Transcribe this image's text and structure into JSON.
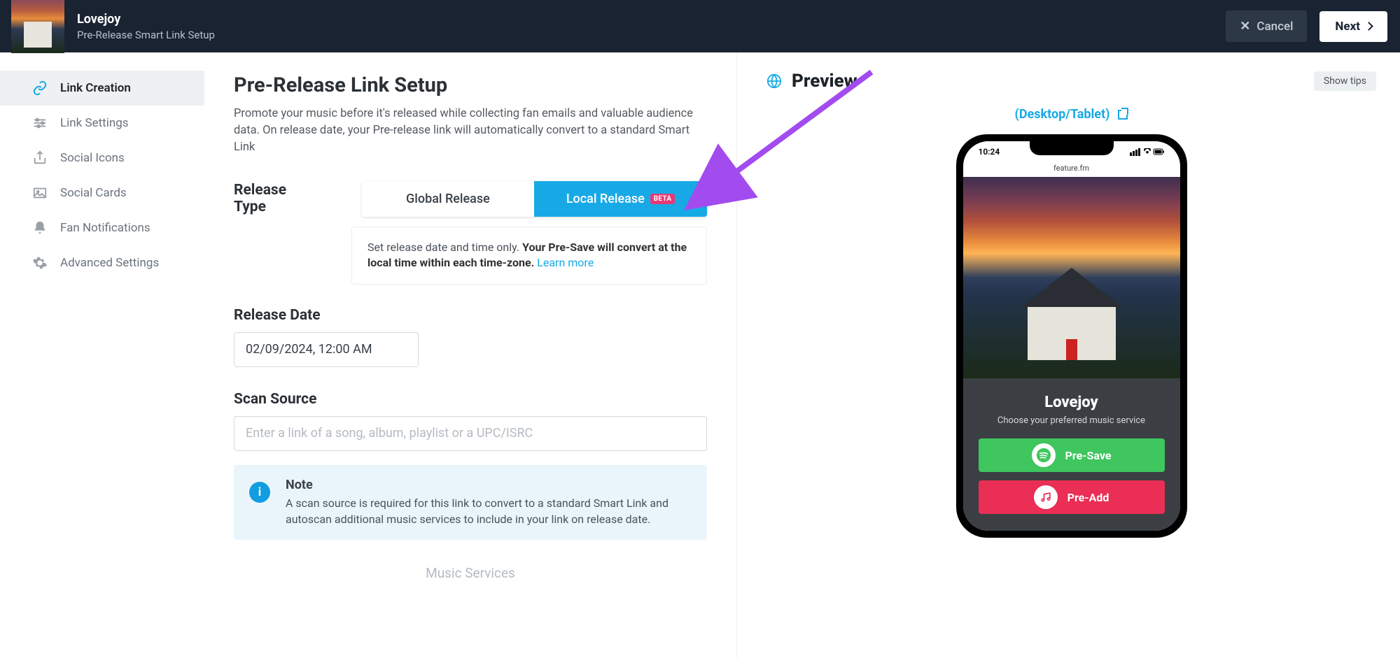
{
  "header": {
    "artist": "Lovejoy",
    "subtitle": "Pre-Release Smart Link Setup",
    "cancel": "Cancel",
    "next": "Next"
  },
  "sidebar": {
    "items": [
      {
        "label": "Link Creation"
      },
      {
        "label": "Link Settings"
      },
      {
        "label": "Social Icons"
      },
      {
        "label": "Social Cards"
      },
      {
        "label": "Fan Notifications"
      },
      {
        "label": "Advanced Settings"
      }
    ]
  },
  "main": {
    "title": "Pre-Release Link Setup",
    "desc": "Promote your music before it's released while collecting fan emails and valuable audience data. On release date, your Pre-release link will automatically convert to a standard Smart Link",
    "release_type_label": "Release Type",
    "global": "Global Release",
    "local": "Local Release",
    "beta": "BETA",
    "info_pre": "Set release date and time only. ",
    "info_bold": "Your Pre-Save will convert at the local time within each time-zone.",
    "info_link": "Learn more",
    "release_date_label": "Release Date",
    "release_date_value": "02/09/2024, 12:00 AM",
    "scan_source_label": "Scan Source",
    "scan_placeholder": "Enter a link of a song, album, playlist or a UPC/ISRC",
    "note_title": "Note",
    "note_body": "A scan source is required for this link to convert to a standard Smart Link and autoscan additional music services to include in your link on release date.",
    "music_services": "Music Services"
  },
  "preview": {
    "title": "Preview",
    "tips": "Show tips",
    "switch": "(Desktop/Tablet)",
    "phone_time": "10:24",
    "phone_url": "feature.fm",
    "artist": "Lovejoy",
    "tagline": "Choose your preferred music service",
    "spotify": "Pre-Save",
    "apple": "Pre-Add"
  }
}
